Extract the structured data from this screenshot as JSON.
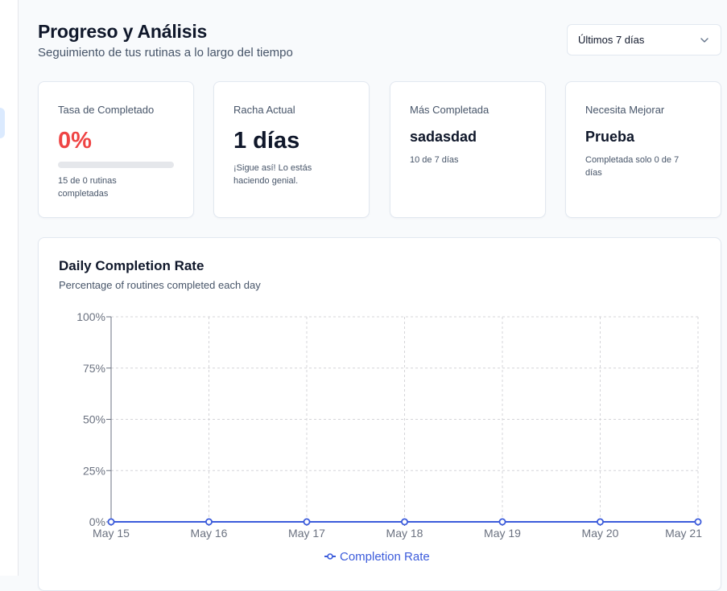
{
  "header": {
    "title": "Progreso y Análisis",
    "subtitle": "Seguimiento de tus rutinas a lo largo del tiempo"
  },
  "range_select": {
    "value": "Últimos 7 días",
    "icon": "chevron-down-icon"
  },
  "stats": {
    "completion": {
      "label": "Tasa de Completado",
      "value": "0%",
      "progress": 0,
      "note_line1": "15 de 0 rutinas",
      "note_line2": "completadas"
    },
    "streak": {
      "label": "Racha Actual",
      "value": "1 días",
      "note_line1": "¡Sigue así! Lo estás",
      "note_line2": "haciendo genial."
    },
    "most_completed": {
      "label": "Más Completada",
      "value": "sadasdad",
      "note": "10 de 7 días"
    },
    "needs_improvement": {
      "label": "Necesita Mejorar",
      "value": "Prueba",
      "note_line1": "Completada solo 0 de 7",
      "note_line2": "días"
    }
  },
  "colors": {
    "danger": "#ef4444",
    "series": "#3b5bdb",
    "grid": "#d4d4d8"
  },
  "chart_data": {
    "type": "line",
    "title": "Daily Completion Rate",
    "subtitle": "Percentage of routines completed each day",
    "categories": [
      "May 15",
      "May 16",
      "May 17",
      "May 18",
      "May 19",
      "May 20",
      "May 21"
    ],
    "y_ticks": [
      "0%",
      "25%",
      "50%",
      "75%",
      "100%"
    ],
    "ylim": [
      0,
      100
    ],
    "grid": true,
    "legend": "bottom-center",
    "series": [
      {
        "name": "Completion Rate",
        "values": [
          0,
          0,
          0,
          0,
          0,
          0,
          0
        ]
      }
    ]
  }
}
